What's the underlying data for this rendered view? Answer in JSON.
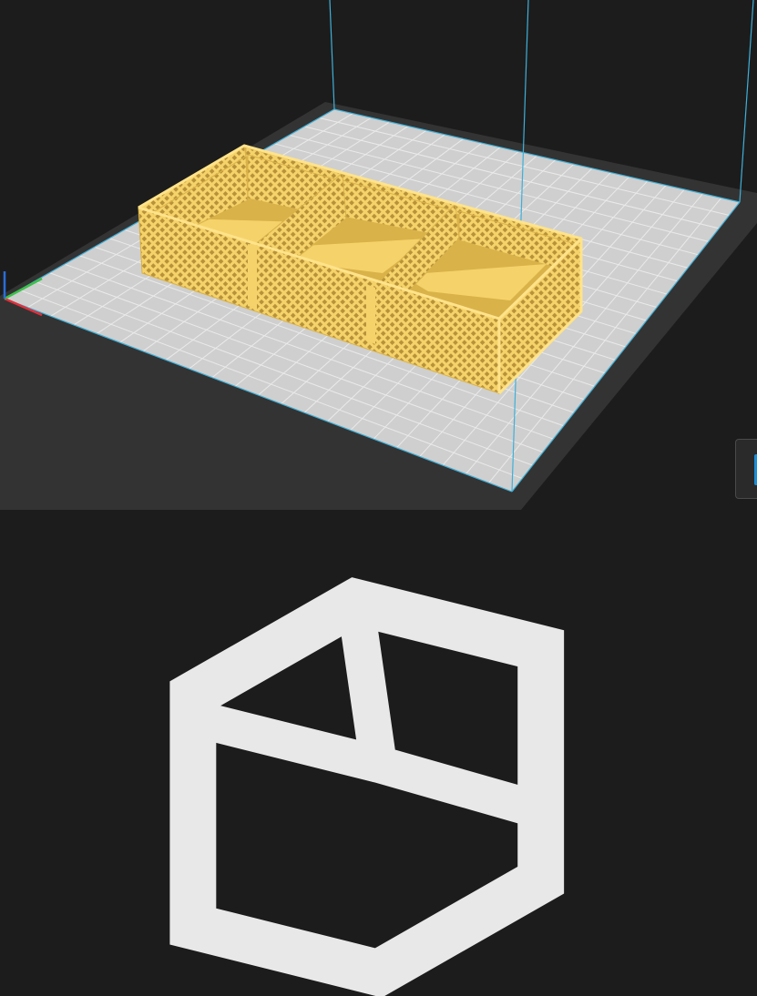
{
  "viewport": {
    "background_color": "#1c1c1c",
    "plate_frame_color": "#333333",
    "plate_surface_color": "#cfcfcf",
    "plate_grid_color": "#eaeaea",
    "volume_edge_color": "#3fb0d8",
    "model_color": "#f5d36a",
    "model_shadow_color": "#d9b24a",
    "axis_x_color": "#e0303c",
    "axis_y_color": "#3cc04a",
    "axis_z_color": "#2a6dd8"
  },
  "controls": {
    "view_icon": "view-cube-icon",
    "side_panel_accent_color": "#1a8fd9"
  }
}
